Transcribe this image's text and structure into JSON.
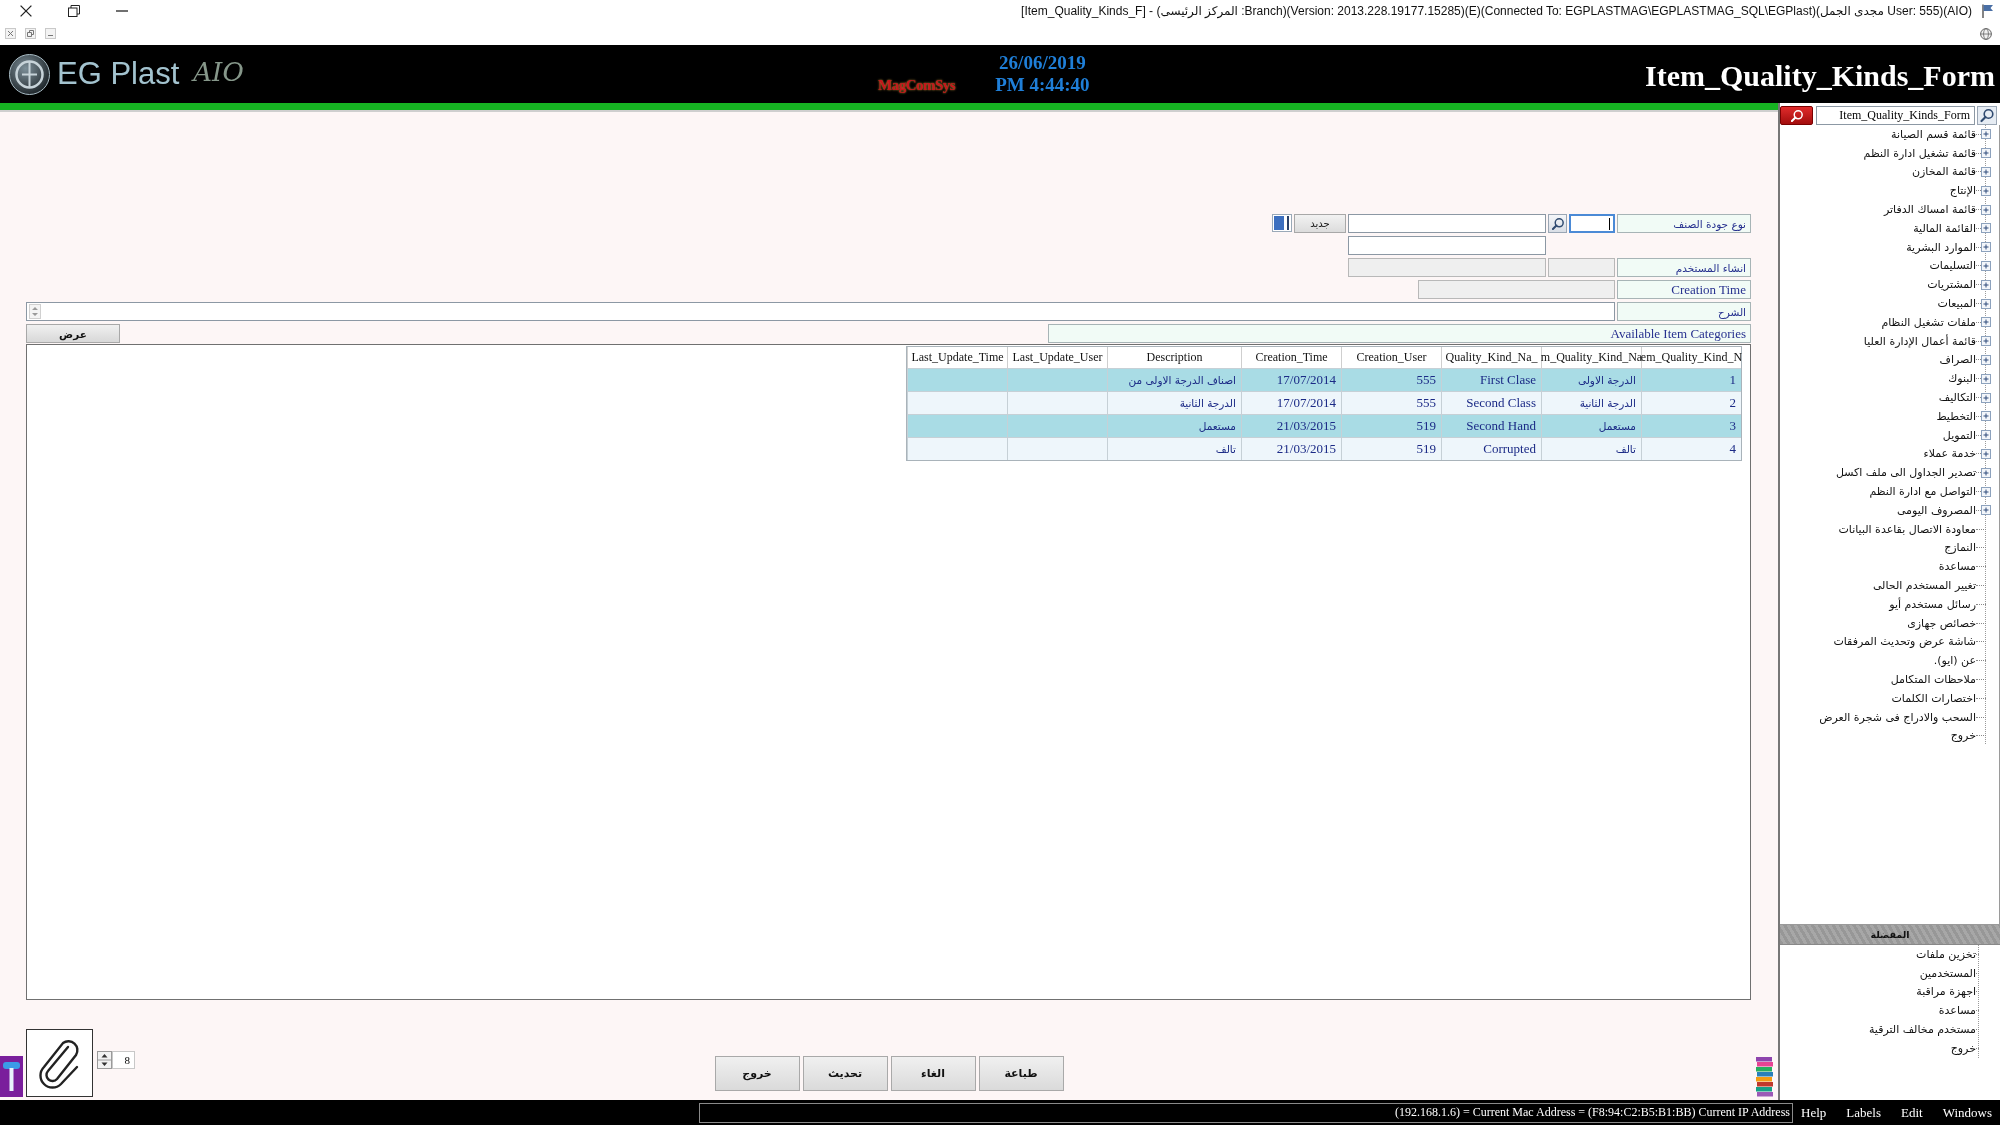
{
  "title_bar": {
    "title": "[Item_Quality_Kinds_F] - (المركز الرئيسى :Branch)(Version: 2013.228.19177.15285)(E)(Connected To: EGPLASTMAG\\EGPLASTMAG_SQL\\EGPlast)(مجدى الجمل User: 555)(AIO)"
  },
  "header": {
    "logo_text": "EG Plast",
    "logo_script": "AIO",
    "vendor": "MagComSys",
    "date": "26/06/2019",
    "time": "PM 4:44:40",
    "form_title": "Item_Quality_Kinds_Form"
  },
  "form": {
    "kind_label": "نوع جودة الصنف",
    "code_field": {
      "focused": true
    },
    "new_button": "جديد",
    "creator_label": "انشاء المستخدم",
    "creation_time_label": "Creation Time",
    "description_label": "الشرح",
    "categories_label": "Available Item Categories",
    "show_button": "عرض"
  },
  "table": {
    "columns": [
      "em_Quality_Kind_N",
      "m_Quality_Kind_Na",
      "_Quality_Kind_Na",
      "Creation_User",
      "Creation_Time",
      "Description",
      "Last_Update_User",
      "Last_Update_Time"
    ],
    "rows": [
      [
        "1",
        "الدرجة الاولى",
        "First Clase",
        "555",
        "17/07/2014",
        "اصناف الدرجة الاولى من"
      ],
      [
        "2",
        "الدرجة الثانية",
        "Second Class",
        "555",
        "17/07/2014",
        "الدرجة الثانية"
      ],
      [
        "3",
        "مستعمل",
        "Second Hand",
        "519",
        "21/03/2015",
        "مستعمل"
      ],
      [
        "4",
        "تالف",
        "Corrupted",
        "519",
        "21/03/2015",
        "تالف"
      ]
    ]
  },
  "attachments": {
    "count": "8"
  },
  "actions": [
    "طباعة",
    "الغاء",
    "تحديث",
    "خروج"
  ],
  "sidebar": {
    "search": {
      "value": "Item_Quality_Kinds_Form"
    },
    "tree": {
      "items": [
        {
          "label": "قائمة قسم الصيانة",
          "kind": "group",
          "expanded": false
        },
        {
          "label": "قائمة تشغيل ادارة النظم",
          "kind": "group",
          "expanded": false
        },
        {
          "label": "قائمة المخازن",
          "kind": "group",
          "expanded": false
        },
        {
          "label": "الإنتاج",
          "kind": "group",
          "expanded": false
        },
        {
          "label": "قائمة امساك الدفاتر",
          "kind": "group",
          "expanded": false
        },
        {
          "label": "القائمة المالية",
          "kind": "group",
          "expanded": false
        },
        {
          "label": "الموارد البشرية",
          "kind": "group",
          "expanded": false
        },
        {
          "label": "التسليمات",
          "kind": "group",
          "expanded": false
        },
        {
          "label": "المشتريات",
          "kind": "group",
          "expanded": false
        },
        {
          "label": "المبيعات",
          "kind": "group",
          "expanded": false
        },
        {
          "label": "ملفات تشغيل النظام",
          "kind": "group",
          "expanded": false
        },
        {
          "label": "قائمة أعمال الإدارة العليا",
          "kind": "group",
          "expanded": false
        },
        {
          "label": "الصراف",
          "kind": "group",
          "expanded": false
        },
        {
          "label": "البنوك",
          "kind": "group",
          "expanded": false
        },
        {
          "label": "التكاليف",
          "kind": "group",
          "expanded": false
        },
        {
          "label": "التخطيط",
          "kind": "group",
          "expanded": false
        },
        {
          "label": "التمويل",
          "kind": "group",
          "expanded": false
        },
        {
          "label": "خدمة عملاء",
          "kind": "group",
          "expanded": false
        },
        {
          "label": "تصدير الجداول الى ملف اكسل",
          "kind": "group",
          "expanded": false
        },
        {
          "label": "التواصل مع ادارة النظم",
          "kind": "group",
          "expanded": false
        },
        {
          "label": "المصروف اليومى",
          "kind": "group",
          "expanded": false
        },
        {
          "label": "معاودة الاتصال بقاعدة البيانات",
          "kind": "command"
        },
        {
          "label": "النمازج",
          "kind": "command"
        },
        {
          "label": "مساعدة",
          "kind": "command"
        },
        {
          "label": "تغيير المستخدم الحالى",
          "kind": "command"
        },
        {
          "label": "رسائل مستخدم أيو",
          "kind": "command"
        },
        {
          "label": "خصائص جهازى",
          "kind": "command"
        },
        {
          "label": "شاشة عرض وتحديث المرفقات",
          "kind": "command"
        },
        {
          "label": "عن (ايو).",
          "kind": "command"
        },
        {
          "label": "ملاحظات المتكامل",
          "kind": "command"
        },
        {
          "label": "اختصارات الكلمات",
          "kind": "command"
        },
        {
          "label": "السحب والادراج فى شجرة العرض",
          "kind": "command"
        },
        {
          "label": "خروج",
          "kind": "command"
        }
      ]
    },
    "favorites": {
      "title": "المفضلة",
      "items": [
        "تخزين ملفات",
        "المستخدمين",
        "اجهزة مراقبة",
        "مساعدة",
        "مستخدم مخالف الترقية",
        "خروج"
      ]
    }
  },
  "status_bar": {
    "text": "(192.168.1.6) = Current Mac Address = (F8:94:C2:B5:B1:BB) Current IP Address",
    "menu": [
      "Windows",
      "Edit",
      "Labels",
      "Help"
    ]
  }
}
